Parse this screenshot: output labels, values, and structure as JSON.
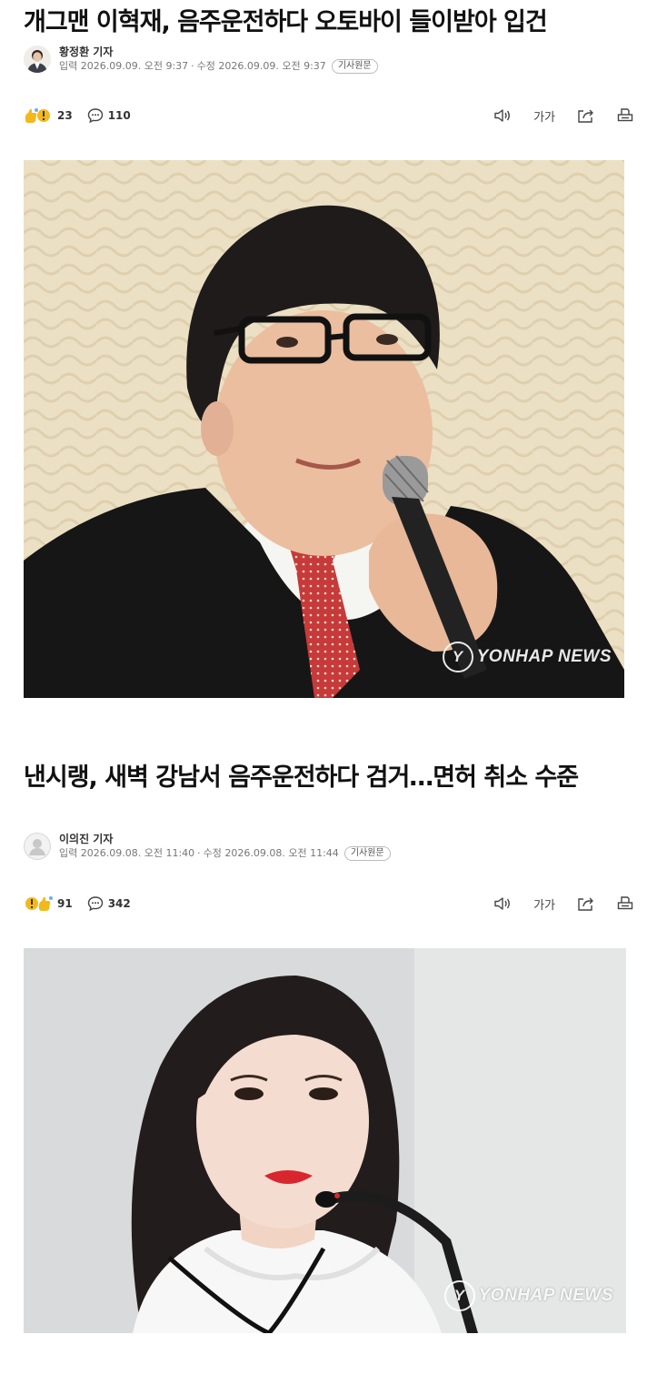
{
  "articles": [
    {
      "title": "개그맨 이혁재, 음주운전하다 오토바이 들이받아 입건",
      "reporter": "황정환 기자",
      "published": "입력 2026.09.09. 오전 9:37",
      "modified": "수정 2026.09.09. 오전 9:37",
      "original_label": "기사원문",
      "reaction_count": "23",
      "comment_count": "110",
      "font_size_label": "가가",
      "watermark": "YONHAP NEWS",
      "watermark_logo": "Y"
    },
    {
      "title": "낸시랭, 새벽 강남서 음주운전하다 검거…면허 취소 수준",
      "reporter": "이의진 기자",
      "published": "입력 2026.09.08. 오전 11:40",
      "modified": "수정 2026.09.08. 오전 11:44",
      "original_label": "기사원문",
      "reaction_count": "91",
      "comment_count": "342",
      "font_size_label": "가가",
      "watermark": "YONHAP NEWS",
      "watermark_logo": "Y"
    }
  ],
  "dot_separator": "·",
  "colors": {
    "accent": "#f3b81c",
    "muted": "#777777"
  }
}
